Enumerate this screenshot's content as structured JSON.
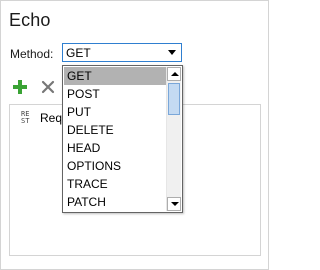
{
  "window": {
    "title": "Echo"
  },
  "form": {
    "method_label": "Method:",
    "selected_method": "GET"
  },
  "toolbar": {
    "add_icon": "plus-icon",
    "delete_icon": "close-icon",
    "add_color": "#3aa335",
    "delete_color": "#777777"
  },
  "list": {
    "rows": [
      {
        "icon": "rest-icon",
        "icon_text_top": "RE",
        "icon_text_bottom": "ST",
        "label": "Requ"
      }
    ]
  },
  "dropdown": {
    "options": [
      "GET",
      "POST",
      "PUT",
      "DELETE",
      "HEAD",
      "OPTIONS",
      "TRACE",
      "PATCH"
    ],
    "highlighted": "GET"
  },
  "colors": {
    "select_border": "#2f7fd0",
    "highlight": "#b2b2b2",
    "scroll_thumb": "#c4daf2"
  }
}
